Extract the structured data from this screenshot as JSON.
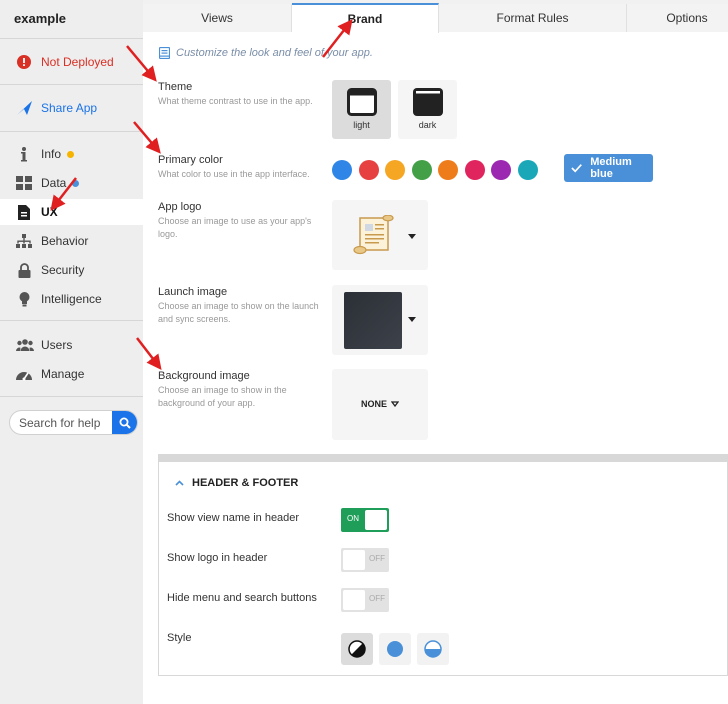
{
  "app": {
    "name": "example"
  },
  "sidebar": {
    "status": {
      "label": "Not Deployed",
      "icon": "alert-circle-icon",
      "color": "#d93025"
    },
    "share": {
      "label": "Share App",
      "icon": "send-icon",
      "color": "#1a73e8"
    },
    "items": [
      {
        "label": "Info",
        "icon": "info-icon",
        "badge_color": "#f6b400"
      },
      {
        "label": "Data",
        "icon": "grid-icon",
        "badge_color": "#4a90d9"
      },
      {
        "label": "UX",
        "icon": "document-icon",
        "active": true
      },
      {
        "label": "Behavior",
        "icon": "hierarchy-icon"
      },
      {
        "label": "Security",
        "icon": "lock-icon"
      },
      {
        "label": "Intelligence",
        "icon": "lightbulb-icon"
      },
      {
        "label": "Users",
        "icon": "users-icon"
      },
      {
        "label": "Manage",
        "icon": "dashboard-icon"
      }
    ],
    "search": {
      "placeholder": "Search for help",
      "icon": "search-icon"
    }
  },
  "tabs": [
    {
      "label": "Views"
    },
    {
      "label": "Brand",
      "active": true
    },
    {
      "label": "Format Rules"
    },
    {
      "label": "Options"
    }
  ],
  "brand": {
    "hint": "Customize the look and feel of your app.",
    "theme": {
      "title": "Theme",
      "desc": "What theme contrast to use in the app.",
      "options": [
        {
          "label": "light",
          "selected": true
        },
        {
          "label": "dark",
          "selected": false
        }
      ]
    },
    "primary_color": {
      "title": "Primary color",
      "desc": "What color to use in the app interface.",
      "swatches": [
        "#2f86e6",
        "#e74040",
        "#f5a623",
        "#43a047",
        "#ef7c1a",
        "#e0245e",
        "#9c27b0",
        "#1aa8b8"
      ],
      "selected_label": "Medium blue",
      "selected_color": "#4a90d9"
    },
    "app_logo": {
      "title": "App logo",
      "desc": "Choose an image to use as your app's logo."
    },
    "launch_image": {
      "title": "Launch image",
      "desc": "Choose an image to show on the launch and sync screens."
    },
    "background_image": {
      "title": "Background image",
      "desc": "Choose an image to show in the background of your app.",
      "value": "NONE"
    }
  },
  "header_footer": {
    "title": "HEADER & FOOTER",
    "rows": [
      {
        "label": "Show view name in header",
        "state": "ON"
      },
      {
        "label": "Show logo in header",
        "state": "OFF"
      },
      {
        "label": "Hide menu and search buttons",
        "state": "OFF"
      }
    ],
    "style_label": "Style"
  },
  "colors": {
    "accent": "#4a90d9",
    "toggle_on": "#1e9e58",
    "annotation": "#e02020"
  }
}
